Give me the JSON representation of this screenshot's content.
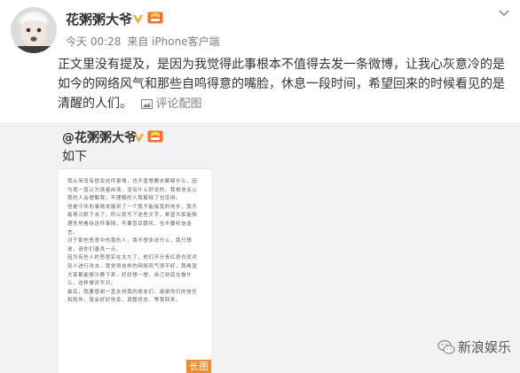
{
  "post": {
    "author": "花粥粥大爷",
    "timestamp": "今天 00:28",
    "source": "来自 iPhone客户端",
    "text": "正文里没有提及，是因为我觉得此事根本不值得去发一条微博，让我心灰意冷的是如今的网络风气和那些自鸣得意的嘴脸，休息一段时间，希望回来的时候看见的是清醒的人们。",
    "image_comment_link": "评论配图",
    "dropdown_icon": "chevron-down-icon",
    "verified_icon": "verified-v-icon",
    "level_icon": "member-level-icon"
  },
  "repost": {
    "author": "@花粥粥大爷",
    "text": "如下",
    "long_image": {
      "badge": "长图",
      "content": "我从来没有提及这件事情，也不曾想要去解释什么，因为我一直认为清者自清，没有什么好说的，我相信关心我的人会理解我，不理解的人我解释了也没用。\n但是今年的事情发展到了一个我不能接受的地步，我不能再沉默下去了，所以我写下这些文字，希望大家能够理性地看待这件事情，不要盲目跟风，也不要听信谣言。\n对于那些恶意中伤我的人，我不想多说什么，我只想说，请你们善良一点。\n因为有些人的恶意实在太大了，他们不分青红皂白就对别人进行攻击，我觉得这样的网络风气很不好，我希望大家都能够冷静下来，好好想一想，自己到底在做什么，这样做对不对。\n最后，我要感谢一直支持我的朋友们，谢谢你们的信任和陪伴，我会好好休息，调整状态，等我回来。"
    }
  },
  "watermark": {
    "text": "新浪娱乐",
    "icon": "wechat-icon"
  }
}
